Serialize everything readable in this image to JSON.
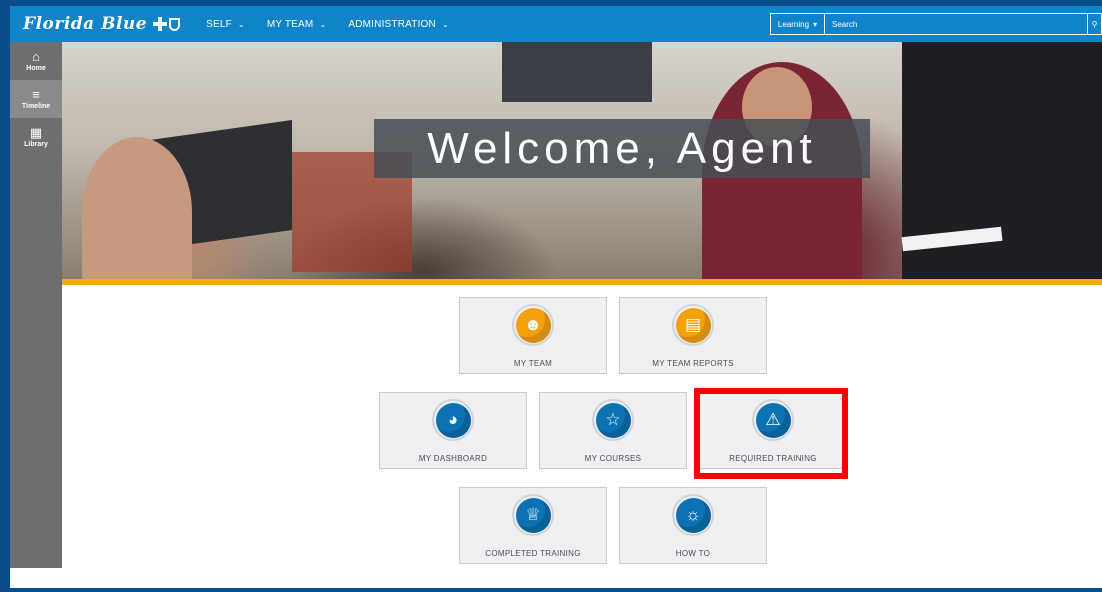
{
  "brand": {
    "name": "Florida Blue"
  },
  "nav": {
    "items": [
      {
        "label": "SELF"
      },
      {
        "label": "MY TEAM"
      },
      {
        "label": "ADMINISTRATION"
      }
    ]
  },
  "search": {
    "scope": "Learning",
    "placeholder": "Search",
    "icon": "search-icon"
  },
  "sidebar": {
    "items": [
      {
        "label": "Home",
        "icon": "home-icon"
      },
      {
        "label": "Timeline",
        "icon": "timeline-icon"
      },
      {
        "label": "Library",
        "icon": "library-icon"
      }
    ]
  },
  "hero": {
    "welcome": "Welcome, Agent"
  },
  "tiles": [
    {
      "label": "MY TEAM",
      "icon": "team-icon",
      "color": "#f5a00f"
    },
    {
      "label": "MY TEAM REPORTS",
      "icon": "report-icon",
      "color": "#f5a00f"
    },
    {
      "label": "MY DASHBOARD",
      "icon": "gauge-icon",
      "color": "#0b72b3"
    },
    {
      "label": "MY COURSES",
      "icon": "book-icon",
      "color": "#0b72b3"
    },
    {
      "label": "REQUIRED TRAINING",
      "icon": "alert-icon",
      "color": "#0b72b3"
    },
    {
      "label": "COMPLETED TRAINING",
      "icon": "trophy-icon",
      "color": "#0b72b3"
    },
    {
      "label": "HOW TO",
      "icon": "lightbulb-icon",
      "color": "#0b72b3"
    }
  ],
  "colors": {
    "topbar": "#0f84c8",
    "accent": "#f5a623",
    "sidebar": "#6e6e6e",
    "highlight": "#ff0000"
  }
}
